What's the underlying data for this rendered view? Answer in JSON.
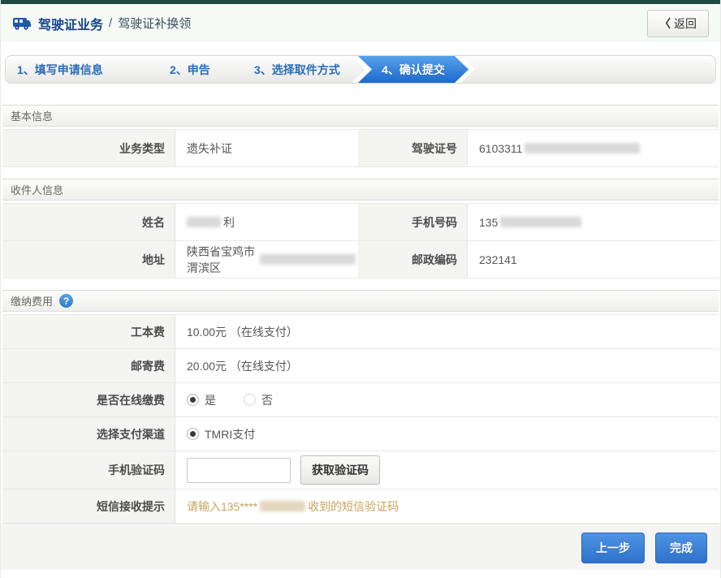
{
  "header": {
    "title": "驾驶证业务",
    "separator": "/",
    "subtitle": "驾驶证补换领",
    "back_chevron": "〈",
    "back_label": "返回"
  },
  "steps": [
    {
      "label": "1、填写申请信息",
      "active": false
    },
    {
      "label": "2、申告",
      "active": false
    },
    {
      "label": "3、选择取件方式",
      "active": false
    },
    {
      "label": "4、确认提交",
      "active": true
    }
  ],
  "basic": {
    "title": "基本信息",
    "business_type_label": "业务类型",
    "business_type_value": "遗失补证",
    "license_no_label": "驾驶证号",
    "license_no_value": "6103311"
  },
  "recipient": {
    "title": "收件人信息",
    "name_label": "姓名",
    "name_value_visible": "利",
    "phone_label": "手机号码",
    "phone_value_visible": "135",
    "address_label": "地址",
    "address_value_visible": "陕西省宝鸡市渭滨区",
    "zip_label": "邮政编码",
    "zip_value": "232141"
  },
  "payment": {
    "title": "缴纳费用",
    "help_glyph": "?",
    "fee_label": "工本费",
    "fee_value": "10.00元 （在线支付）",
    "postage_label": "邮寄费",
    "postage_value": "20.00元 （在线支付）",
    "online_pay_label": "是否在线缴费",
    "online_pay_yes": "是",
    "online_pay_no": "否",
    "channel_label": "选择支付渠道",
    "channel_option": "TMRI支付",
    "captcha_label": "手机验证码",
    "captcha_input_value": "",
    "captcha_button": "获取验证码",
    "sms_label": "短信接收提示",
    "sms_hint_prefix": "请输入135****",
    "sms_hint_suffix": "收到的短信验证码"
  },
  "footer": {
    "prev_label": "上一步",
    "done_label": "完成"
  },
  "colors": {
    "topbar_teal": "#1f4a42",
    "accent_blue": "#2f7ed8",
    "step_text_blue": "#2b6cb8",
    "hint_orange": "#c9a35e"
  }
}
